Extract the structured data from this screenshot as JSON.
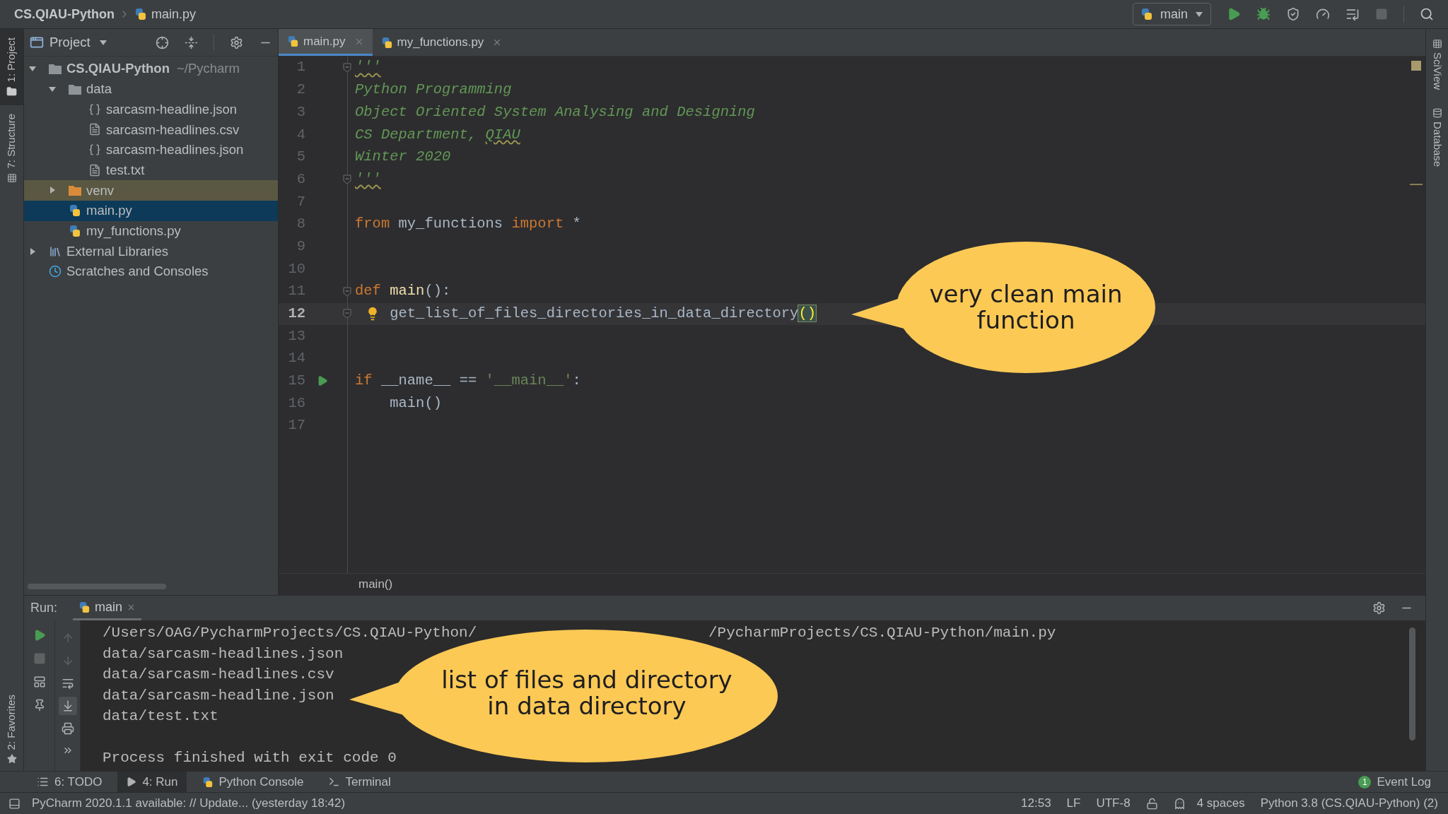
{
  "breadcrumb": {
    "project": "CS.QIAU-Python",
    "file": "main.py"
  },
  "run_config": {
    "label": "main"
  },
  "toolbar": [
    {
      "kind": "run",
      "disabled": false
    },
    {
      "kind": "debug",
      "disabled": false
    },
    {
      "kind": "coverage",
      "disabled": false
    },
    {
      "kind": "profile",
      "disabled": false
    },
    {
      "kind": "concurrency",
      "disabled": false
    },
    {
      "kind": "stop",
      "disabled": true
    }
  ],
  "left_stripe": [
    {
      "label": "1: Project",
      "kind": "project",
      "selected": true
    },
    {
      "label": "7: Structure",
      "kind": "structure",
      "selected": false
    }
  ],
  "left_stripe_bottom": [
    {
      "label": "2: Favorites",
      "kind": "favorites",
      "selected": false
    }
  ],
  "right_stripe": [
    {
      "label": "SciView",
      "kind": "sciview"
    },
    {
      "label": "Database",
      "kind": "database"
    }
  ],
  "project_panel": {
    "title": "Project",
    "tree": [
      {
        "label": "CS.QIAU-Python",
        "hint": "~/Pycharm",
        "kind": "project",
        "expanded": true,
        "selected": false,
        "children": [
          {
            "label": "data",
            "kind": "folder",
            "expanded": true,
            "selected": false,
            "children": [
              {
                "label": "sarcasm-headline.json",
                "kind": "json",
                "selected": false
              },
              {
                "label": "sarcasm-headlines.csv",
                "kind": "text",
                "selected": false
              },
              {
                "label": "sarcasm-headlines.json",
                "kind": "json",
                "selected": false
              },
              {
                "label": "test.txt",
                "kind": "text",
                "selected": false
              }
            ]
          },
          {
            "label": "venv",
            "kind": "excluded-folder",
            "expanded": false,
            "selected": false
          },
          {
            "label": "main.py",
            "kind": "python",
            "selected": true
          },
          {
            "label": "my_functions.py",
            "kind": "python",
            "selected": false
          }
        ]
      },
      {
        "label": "External Libraries",
        "kind": "libraries",
        "expanded": false,
        "selected": false
      },
      {
        "label": "Scratches and Consoles",
        "kind": "scratches",
        "selected": false
      }
    ]
  },
  "editor_tabs": [
    {
      "label": "main.py",
      "selected": true
    },
    {
      "label": "my_functions.py",
      "selected": false
    }
  ],
  "code": [
    {
      "number": "1",
      "fold": true,
      "current": false,
      "tokens": [
        {
          "kind": "doc-typo",
          "text": "'''"
        }
      ]
    },
    {
      "number": "2",
      "fold": false,
      "current": false,
      "tokens": [
        {
          "kind": "doc",
          "text": "Python Programming"
        }
      ]
    },
    {
      "number": "3",
      "fold": false,
      "current": false,
      "tokens": [
        {
          "kind": "doc",
          "text": "Object Oriented System Analysing and Designing"
        }
      ]
    },
    {
      "number": "4",
      "fold": false,
      "current": false,
      "tokens": [
        {
          "kind": "doc",
          "text": "CS Department, "
        },
        {
          "kind": "doc-typo",
          "text": "QIAU"
        }
      ]
    },
    {
      "number": "5",
      "fold": false,
      "current": false,
      "tokens": [
        {
          "kind": "doc",
          "text": "Winter 2020"
        }
      ]
    },
    {
      "number": "6",
      "fold": true,
      "current": false,
      "tokens": [
        {
          "kind": "doc-typo",
          "text": "'''"
        }
      ]
    },
    {
      "number": "7",
      "fold": false,
      "current": false
    },
    {
      "number": "8",
      "fold": false,
      "current": false,
      "tokens": [
        {
          "kind": "keyword",
          "text": "from"
        },
        {
          "kind": "plain",
          "text": " my_functions "
        },
        {
          "kind": "keyword",
          "text": "import"
        },
        {
          "kind": "plain",
          "text": " *"
        }
      ]
    },
    {
      "number": "9",
      "fold": false,
      "current": false
    },
    {
      "number": "10",
      "fold": false,
      "current": false
    },
    {
      "number": "11",
      "fold": true,
      "current": false,
      "tokens": [
        {
          "kind": "keyword",
          "text": "def "
        },
        {
          "kind": "function",
          "text": "main"
        },
        {
          "kind": "plain",
          "text": "():"
        }
      ]
    },
    {
      "number": "12",
      "fold": true,
      "current": true,
      "indented": true,
      "kind": "intention",
      "tokens": [
        {
          "kind": "plain",
          "text": "get_list_of_files_directories_in_data_directory"
        },
        {
          "kind": "brace-match",
          "text": "()"
        }
      ]
    },
    {
      "number": "13",
      "fold": false,
      "current": false
    },
    {
      "number": "14",
      "fold": false,
      "current": false
    },
    {
      "number": "15",
      "fold": false,
      "current": false,
      "kind": "runnable",
      "tokens": [
        {
          "kind": "keyword",
          "text": "if"
        },
        {
          "kind": "plain",
          "text": " __name__ == "
        },
        {
          "kind": "string",
          "text": "'__main__'"
        },
        {
          "kind": "plain",
          "text": ":"
        }
      ]
    },
    {
      "number": "16",
      "fold": false,
      "current": false,
      "indented": true,
      "tokens": [
        {
          "kind": "plain",
          "text": "main()"
        }
      ]
    },
    {
      "number": "17",
      "fold": false,
      "current": false
    }
  ],
  "editor_breadcrumb": "main()",
  "callouts": [
    {
      "lines": [
        "very clean main",
        "function"
      ]
    },
    {
      "lines": [
        "list of files and directory",
        "in data directory"
      ]
    }
  ],
  "run_panel": {
    "label": "Run:",
    "tab": "main",
    "tools_left": [
      {
        "kind": "rerun",
        "disabled": false
      },
      {
        "kind": "stop",
        "disabled": true
      },
      {
        "kind": "layout",
        "disabled": false
      },
      {
        "kind": "pin",
        "disabled": false
      }
    ],
    "tools_right": [
      {
        "kind": "up",
        "disabled": true,
        "selected": false
      },
      {
        "kind": "down",
        "disabled": true,
        "selected": false
      },
      {
        "kind": "wrap",
        "disabled": false,
        "selected": false
      },
      {
        "kind": "scroll-end",
        "disabled": false,
        "selected": true
      },
      {
        "kind": "print",
        "disabled": false,
        "selected": false
      },
      {
        "kind": "more",
        "disabled": false,
        "selected": false
      }
    ],
    "output": [
      {
        "kind": "command",
        "parts": [
          "/Users/OAG/PycharmProjects/CS.QIAU-Python/",
          "/PycharmProjects/CS.QIAU-Python/main.py"
        ]
      },
      {
        "kind": "text",
        "text": "data/sarcasm-headlines.json"
      },
      {
        "kind": "text",
        "text": "data/sarcasm-headlines.csv"
      },
      {
        "kind": "text",
        "text": "data/sarcasm-headline.json"
      },
      {
        "kind": "text",
        "text": "data/test.txt"
      },
      {
        "kind": "blank"
      },
      {
        "kind": "text",
        "text": "Process finished with exit code 0"
      }
    ]
  },
  "bottom_tabs": [
    {
      "label": "6: TODO",
      "kind": "todo",
      "selected": false
    },
    {
      "label": "4: Run",
      "kind": "run",
      "selected": true
    },
    {
      "label": "Python Console",
      "kind": "console",
      "selected": false
    },
    {
      "label": "Terminal",
      "kind": "terminal",
      "selected": false
    }
  ],
  "event_log": {
    "label": "Event Log",
    "count": "1"
  },
  "status": {
    "message": "PyCharm 2020.1.1 available: // Update... (yesterday 18:42)",
    "position": "12:53",
    "line_separator": "LF",
    "encoding": "UTF-8",
    "indent": "4 spaces",
    "interpreter": "Python 3.8 (CS.QIAU-Python) (2)"
  }
}
